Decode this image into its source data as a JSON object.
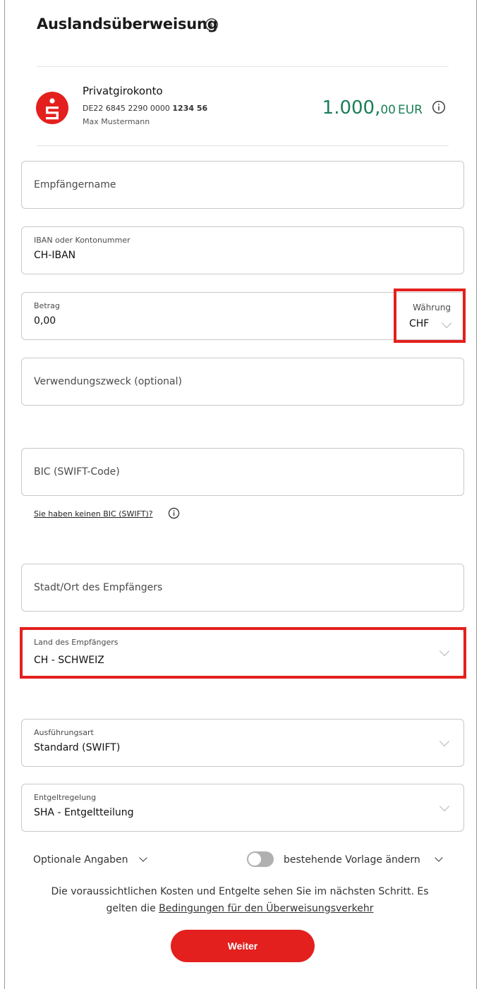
{
  "header": {
    "title": "Auslandsüberweisung"
  },
  "account": {
    "name": "Privatgirokonto",
    "iban_prefix": "DE22 6845 2290 0000",
    "iban_suffix": "1234 56",
    "holder": "Max Mustermann",
    "balance_main": "1.000,",
    "balance_decimals": "00",
    "balance_currency": "EUR"
  },
  "form": {
    "recipient_name": {
      "placeholder": "Empfängername"
    },
    "iban": {
      "label": "IBAN oder Kontonummer",
      "value": "CH-IBAN"
    },
    "amount": {
      "label": "Betrag",
      "value": "0,00"
    },
    "currency": {
      "label": "Währung",
      "value": "CHF"
    },
    "purpose": {
      "placeholder": "Verwendungszweck (optional)"
    },
    "bic": {
      "placeholder": "BIC (SWIFT-Code)"
    },
    "no_bic_link": "Sie haben keinen BIC (SWIFT)?",
    "city": {
      "placeholder": "Stadt/Ort des Empfängers"
    },
    "country": {
      "label": "Land des Empfängers",
      "value": "CH - SCHWEIZ"
    },
    "execution": {
      "label": "Ausführungsart",
      "value": "Standard (SWIFT)"
    },
    "fees": {
      "label": "Entgeltregelung",
      "value": "SHA - Entgeltteilung"
    }
  },
  "options": {
    "optional_label": "Optionale Angaben",
    "template_label": "bestehende Vorlage ändern"
  },
  "note": {
    "text": "Die voraussichtlichen Kosten und Entgelte sehen Sie im nächsten Schritt. Es gelten die",
    "link": "Bedingungen für den Überweisungsverkehr"
  },
  "cta": {
    "label": "Weiter"
  },
  "colors": {
    "brand_red": "#e3201e",
    "balance_green": "#1b7f57"
  }
}
